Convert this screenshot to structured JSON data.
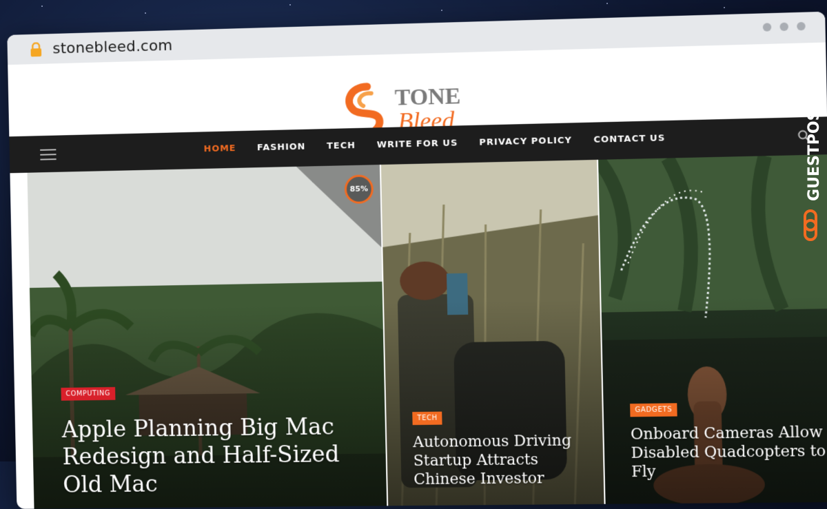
{
  "browser": {
    "url": "stonebleed.com"
  },
  "logo": {
    "line1": "TONE",
    "line2": "Bleed",
    "accent_color": "#f26b21"
  },
  "nav": {
    "items": [
      "HOME",
      "FASHION",
      "TECH",
      "WRITE FOR US",
      "PRIVACY POLICY",
      "CONTACT US"
    ],
    "active_index": 0
  },
  "cards": [
    {
      "category": "COMPUTING",
      "title": "Apple Planning Big Mac Redesign and Half-Sized Old Mac",
      "score": "85%"
    },
    {
      "category": "TECH",
      "title": "Autonomous Driving Startup Attracts Chinese Investor"
    },
    {
      "category": "GADGETS",
      "title": "Onboard Cameras Allow Disabled Quadcopters to Fly"
    }
  ],
  "side_badge": {
    "text": "GUESTPOSTLINKS"
  },
  "colors": {
    "accent": "#f26b21",
    "nav_bg": "#1d1d1d",
    "tag_red": "#d8202a"
  }
}
